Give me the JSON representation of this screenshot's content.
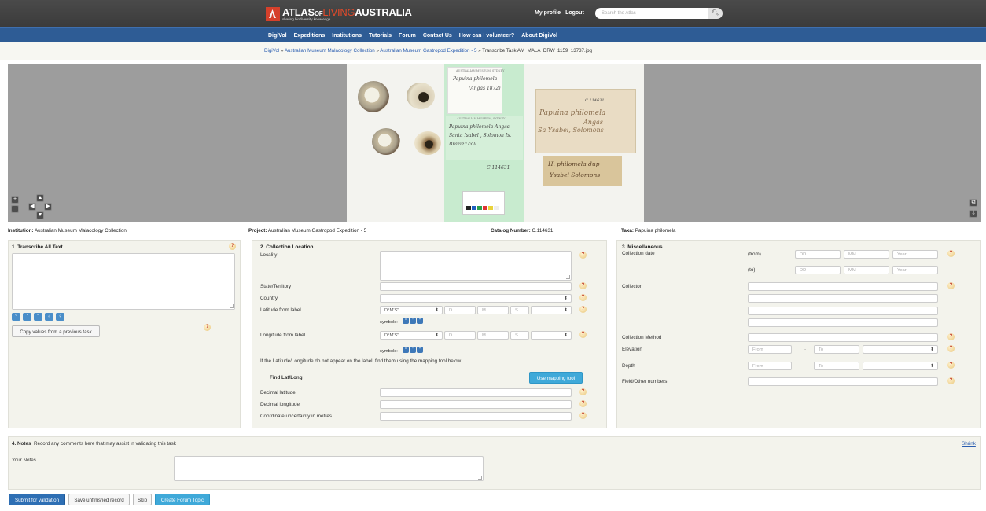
{
  "header": {
    "logo_atlas": "ATLAS",
    "logo_of": "OF",
    "logo_living": "LIVING",
    "logo_australia": "AUSTRALIA",
    "logo_tagline": "sharing biodiversity knowledge",
    "profile_link": "My profile",
    "logout_link": "Logout",
    "search_placeholder": "Search the Atlas",
    "search_icon": "magnifier-icon"
  },
  "nav": {
    "items": [
      "DigiVol",
      "Expeditions",
      "Institutions",
      "Tutorials",
      "Forum",
      "Contact Us",
      "How can I volunteer?",
      "About DigiVol"
    ]
  },
  "breadcrumb": {
    "items": [
      "DigiVol",
      "Australian Museum Malacology Collection",
      "Australian Museum Gastropod Expedition - 5"
    ],
    "separator": "»",
    "current": "Transcribe Task AM_MALA_DRW_1159_13737.jpg"
  },
  "specimen_labels": {
    "museum_heading": "AUSTRALIAN MUSEUM, SYDNEY",
    "green_top_name": "Papuina philomela",
    "green_top_author": "(Angas 1872)",
    "green_bottom_line1": "Papuina philomela Angas",
    "green_bottom_line2": "Santa Isabel , Solomon Is.",
    "green_bottom_line3": "Brazier coll.",
    "green_catalog": "C 114631",
    "ms_catalog": "C 114631",
    "ms_line1": "Papuina philomela",
    "ms_line2": "Angas",
    "ms_line3": "Sa Ysabel, Solomons",
    "ms_small_line1": "H. philomela dup",
    "ms_small_line2": "Ysabel Solomons"
  },
  "meta": {
    "institution_label": "Institution:",
    "institution_value": "Australian Museum Malacology Collection",
    "project_label": "Project:",
    "project_value": "Australian Museum Gastropod Expedition - 5",
    "catalog_label": "Catalog Number:",
    "catalog_value": "C.114631",
    "taxa_label": "Taxa:",
    "taxa_value": "Papuina philomela"
  },
  "transcribe": {
    "title": "1. Transcribe All Text",
    "toolbar_icons": [
      "degree-icon",
      "minute-icon",
      "second-icon",
      "male-icon",
      "female-icon"
    ],
    "toolbar_glyphs": [
      "°",
      "'",
      "\"",
      "♂",
      "♀"
    ],
    "copy_button": "Copy values from a previous task"
  },
  "collection_location": {
    "title": "2. Collection Location",
    "locality_label": "Locality",
    "state_label": "State/Territory",
    "country_label": "Country",
    "latitude_label": "Latitude from label",
    "longitude_label": "Longitude from label",
    "format_value": "D°M'S\"",
    "deg_placeholder": "D",
    "min_placeholder": "M",
    "sec_placeholder": "S",
    "symbols_label": "symbols:",
    "symbol_glyphs": [
      "°",
      "'",
      "\""
    ],
    "mapping_hint": "If the Latitude/Longitude do not appear on the label, find them using the mapping tool below",
    "find_heading": "Find Lat/Long",
    "mapping_button": "Use mapping tool",
    "decimal_lat_label": "Decimal latitude",
    "decimal_long_label": "Decimal longitude",
    "uncertainty_label": "Coordinate uncertainty in metres"
  },
  "misc": {
    "title": "3. Miscellaneous",
    "collection_date_label": "Collection date",
    "from_label": "(from)",
    "to_label": "(to)",
    "dd_placeholder": "DD",
    "mm_placeholder": "MM",
    "year_placeholder": "Year",
    "collector_label": "Collector",
    "method_label": "Collection Method",
    "elevation_label": "Elevation",
    "depth_label": "Depth",
    "range_from_placeholder": "From",
    "range_to_placeholder": "To",
    "range_dash": "-",
    "field_numbers_label": "Field/Other numbers"
  },
  "notes": {
    "title": "4. Notes",
    "hint": "Record any comments here that may assist in validating this task",
    "shrink_link": "Shrink",
    "your_notes_label": "Your Notes"
  },
  "actions": {
    "submit": "Submit for validation",
    "save": "Save unfinished record",
    "skip": "Skip",
    "forum": "Create Forum Topic"
  },
  "viewer_controls": {
    "zoom_in": "+",
    "zoom_out": "−",
    "pan_up": "▲",
    "pan_down": "▼",
    "pan_left": "◀",
    "pan_right": "▶",
    "popout": "⧉",
    "expand": "⇩"
  },
  "help_glyph": "?",
  "colors": {
    "topbar": "#3b3b3b",
    "navbar": "#2e5c95",
    "panel": "#f3f3ec",
    "viewer": "#9d9d9d",
    "submit": "#2e6fb4",
    "forum": "#3fa9d9"
  }
}
